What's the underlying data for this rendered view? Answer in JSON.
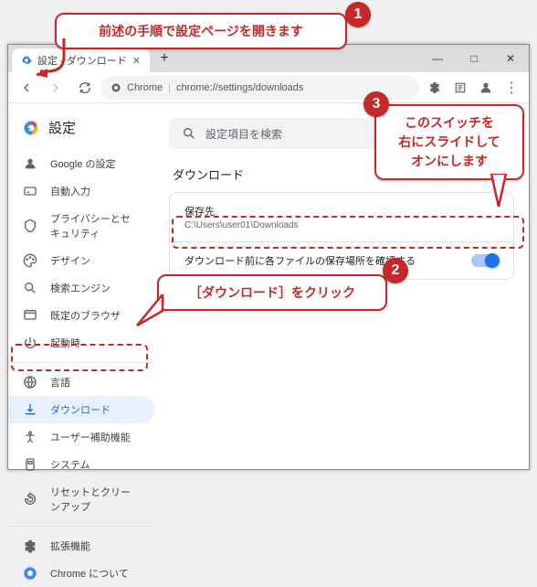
{
  "window": {
    "tab_title": "設定 - ダウンロード",
    "url_label": "Chrome",
    "url_path": "chrome://settings/downloads"
  },
  "sidebar": {
    "app_title": "設定",
    "items": [
      {
        "icon": "person",
        "label": "Google の設定"
      },
      {
        "icon": "autofill",
        "label": "自動入力"
      },
      {
        "icon": "privacy",
        "label": "プライバシーとセキュリティ"
      },
      {
        "icon": "design",
        "label": "デザイン"
      },
      {
        "icon": "search",
        "label": "検索エンジン"
      },
      {
        "icon": "browser",
        "label": "既定のブラウザ"
      },
      {
        "icon": "power",
        "label": "起動時"
      }
    ],
    "items2": [
      {
        "icon": "lang",
        "label": "言語"
      },
      {
        "icon": "download",
        "label": "ダウンロード",
        "selected": true
      },
      {
        "icon": "a11y",
        "label": "ユーザー補助機能"
      },
      {
        "icon": "system",
        "label": "システム"
      },
      {
        "icon": "reset",
        "label": "リセットとクリーンアップ"
      }
    ],
    "items3": [
      {
        "icon": "ext",
        "label": "拡張機能"
      },
      {
        "icon": "about",
        "label": "Chrome について"
      }
    ]
  },
  "main": {
    "search_placeholder": "設定項目を検索",
    "section_title": "ダウンロード",
    "save_location_label": "保存先",
    "save_location_value": "C:\\Users\\user01\\Downloads",
    "ask_location_label": "ダウンロード前に各ファイルの保存場所を確認する"
  },
  "callouts": {
    "c1": "前述の手順で設定ページを開きます",
    "c2": "［ダウンロード］をクリック",
    "c3_l1": "このスイッチを",
    "c3_l2": "右にスライドして",
    "c3_l3": "オンにします"
  }
}
